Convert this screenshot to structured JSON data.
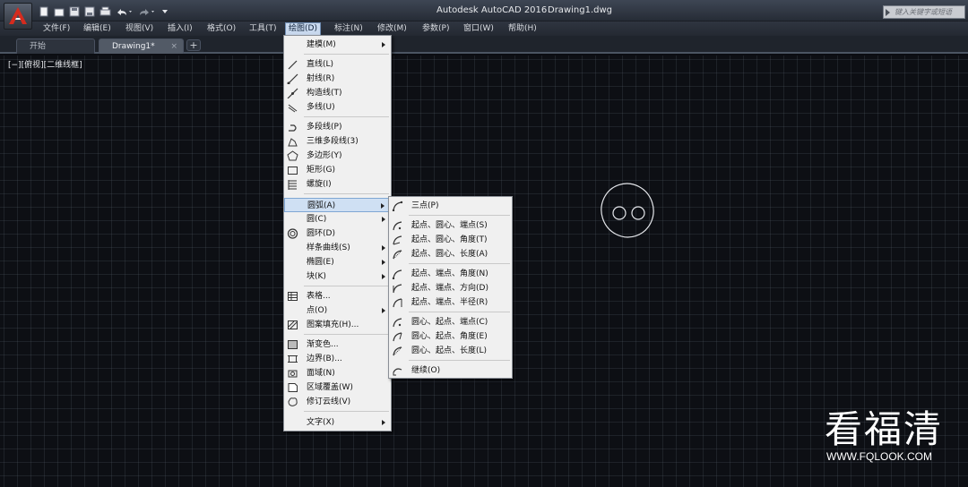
{
  "window": {
    "app_title": "Autodesk AutoCAD 2016",
    "file_title": "Drawing1.dwg",
    "search_placeholder": "键入关键字或短语"
  },
  "menubar": {
    "items": [
      "文件(F)",
      "编辑(E)",
      "视图(V)",
      "插入(I)",
      "格式(O)",
      "工具(T)",
      "绘图(D)",
      "标注(N)",
      "修改(M)",
      "参数(P)",
      "窗口(W)",
      "帮助(H)"
    ],
    "active": "绘图(D)"
  },
  "tabs": {
    "start": "开始",
    "drawing": "Drawing1*",
    "close": "×",
    "add": "+"
  },
  "viewport": {
    "label": "[−][俯视][二维线框]"
  },
  "draw_menu": {
    "items": [
      {
        "label": "建模(M)",
        "icon": "none",
        "submenu": true
      },
      {
        "label": "直线(L)",
        "icon": "line-icon"
      },
      {
        "label": "射线(R)",
        "icon": "ray-icon"
      },
      {
        "label": "构造线(T)",
        "icon": "xline-icon"
      },
      {
        "label": "多线(U)",
        "icon": "multiline-icon"
      },
      {
        "label": "多段线(P)",
        "icon": "polyline-icon"
      },
      {
        "label": "三维多段线(3)",
        "icon": "3d-polyline-icon"
      },
      {
        "label": "多边形(Y)",
        "icon": "polygon-icon"
      },
      {
        "label": "矩形(G)",
        "icon": "rectangle-icon"
      },
      {
        "label": "螺旋(I)",
        "icon": "helix-icon"
      },
      {
        "label": "圆弧(A)",
        "icon": "none",
        "submenu": true,
        "highlighted": true
      },
      {
        "label": "圆(C)",
        "icon": "none",
        "submenu": true
      },
      {
        "label": "圆环(D)",
        "icon": "donut-icon"
      },
      {
        "label": "样条曲线(S)",
        "icon": "none",
        "submenu": true
      },
      {
        "label": "椭圆(E)",
        "icon": "none",
        "submenu": true
      },
      {
        "label": "块(K)",
        "icon": "none",
        "submenu": true
      },
      {
        "label": "表格...",
        "icon": "table-icon"
      },
      {
        "label": "点(O)",
        "icon": "none",
        "submenu": true
      },
      {
        "label": "图案填充(H)...",
        "icon": "hatch-icon"
      },
      {
        "label": "渐变色...",
        "icon": "gradient-icon"
      },
      {
        "label": "边界(B)...",
        "icon": "boundary-icon"
      },
      {
        "label": "面域(N)",
        "icon": "region-icon"
      },
      {
        "label": "区域覆盖(W)",
        "icon": "wipeout-icon"
      },
      {
        "label": "修订云线(V)",
        "icon": "revcloud-icon"
      },
      {
        "label": "文字(X)",
        "icon": "none",
        "submenu": true
      }
    ]
  },
  "arc_menu": {
    "items": [
      {
        "label": "三点(P)"
      },
      {
        "label": "起点、圆心、端点(S)"
      },
      {
        "label": "起点、圆心、角度(T)"
      },
      {
        "label": "起点、圆心、长度(A)"
      },
      {
        "label": "起点、端点、角度(N)"
      },
      {
        "label": "起点、端点、方向(D)"
      },
      {
        "label": "起点、端点、半径(R)"
      },
      {
        "label": "圆心、起点、端点(C)"
      },
      {
        "label": "圆心、起点、角度(E)"
      },
      {
        "label": "圆心、起点、长度(L)"
      },
      {
        "label": "继续(O)"
      }
    ]
  },
  "watermark": {
    "chinese": "看福清",
    "url": "WWW.FQLOOK.COM"
  }
}
